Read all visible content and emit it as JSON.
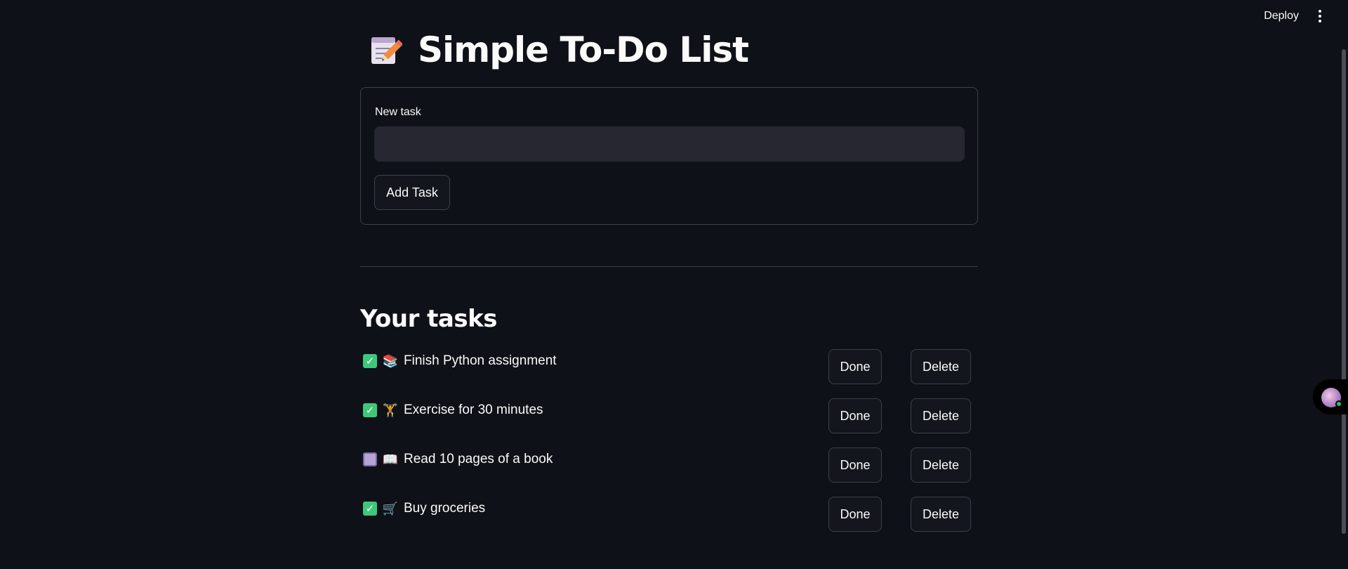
{
  "header": {
    "deploy_label": "Deploy"
  },
  "page": {
    "title": "Simple To-Do List"
  },
  "form": {
    "input_label": "New task",
    "input_value": "",
    "add_button_label": "Add Task"
  },
  "tasks_section": {
    "title": "Your tasks",
    "items": [
      {
        "label": "Finish Python assignment",
        "done": true,
        "icon": "books-icon",
        "emoji": "📚",
        "done_label": "Done",
        "delete_label": "Delete"
      },
      {
        "label": "Exercise for 30 minutes",
        "done": true,
        "icon": "weightlifter-icon",
        "emoji": "🏋️",
        "done_label": "Done",
        "delete_label": "Delete"
      },
      {
        "label": "Read 10 pages of a book",
        "done": false,
        "icon": "open-book-icon",
        "emoji": "📖",
        "done_label": "Done",
        "delete_label": "Delete"
      },
      {
        "label": "Buy groceries",
        "done": true,
        "icon": "shopping-cart-icon",
        "emoji": "🛒",
        "done_label": "Done",
        "delete_label": "Delete"
      }
    ]
  },
  "colors": {
    "background": "#0e1117",
    "input_bg": "#262730",
    "border": "#3d4049",
    "checked": "#3ec77b",
    "unchecked": "#b6a3d6"
  }
}
